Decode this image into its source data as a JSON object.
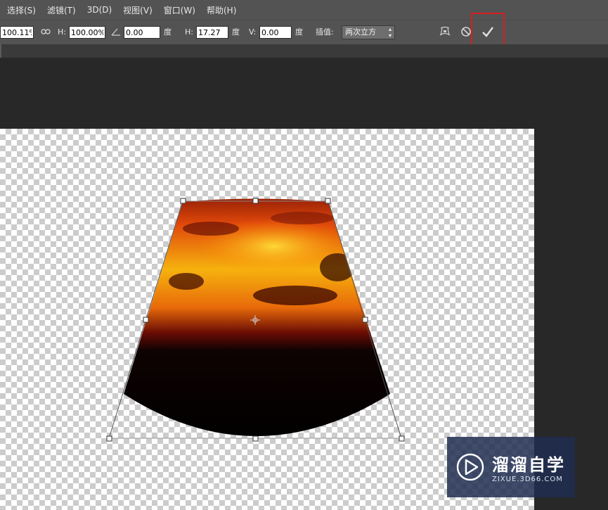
{
  "menu": {
    "items": [
      "选择(S)",
      "滤镜(T)",
      "3D(D)",
      "视图(V)",
      "窗口(W)",
      "帮助(H)"
    ]
  },
  "options": {
    "width_value": "100.11%",
    "height_label": "H:",
    "height_value": "100.00%",
    "angle_value": "0.00",
    "angle_unit": "度",
    "hskew_label": "H:",
    "hskew_value": "17.27",
    "hskew_unit": "度",
    "vskew_label": "V:",
    "vskew_value": "0.00",
    "vskew_unit": "度",
    "interp_label": "插值:",
    "interp_value": "两次立方"
  },
  "watermark": {
    "name": "溜溜自学",
    "url": "ZIXUE.3D66.COM"
  },
  "colors": {
    "commit_highlight": "#d81e1e",
    "panel": "#535353",
    "workspace": "#282828"
  },
  "icons": [
    "link-icon",
    "angle-icon",
    "warp-icon",
    "cancel-icon",
    "commit-check-icon",
    "play-logo-icon"
  ]
}
